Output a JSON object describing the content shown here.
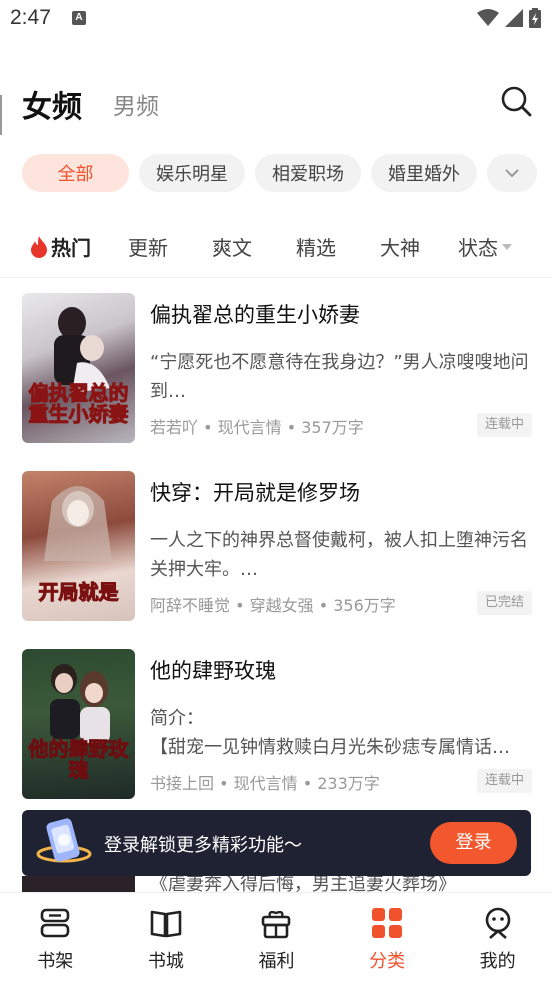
{
  "status_bar": {
    "time": "2:47",
    "notification": "A"
  },
  "top_tabs": {
    "female": "女频",
    "male": "男频"
  },
  "genre_chips": [
    "全部",
    "娱乐明星",
    "相爱职场",
    "婚里婚外"
  ],
  "sort_tabs": {
    "hot": "热门",
    "items": [
      "更新",
      "爽文",
      "精选",
      "大神"
    ],
    "status": "状态"
  },
  "books": [
    {
      "title": "偏执翟总的重生小娇妻",
      "desc": "“宁愿死也不愿意待在我身边？”男人凉嗖嗖地问到…",
      "meta": "若若吖 • 现代言情 • 357万字",
      "badge": "连载中",
      "cover_text": "偏执翟总的重生小娇妻"
    },
    {
      "title": "快穿：开局就是修罗场",
      "desc": "一人之下的神界总督使戴柯，被人扣上堕神污名关押大牢。…",
      "meta": "阿辞不睡觉 • 穿越女强 • 356万字",
      "badge": "已完结",
      "cover_text": "开局就是"
    },
    {
      "title": "他的肆野玫瑰",
      "desc": "简介：\n【甜宠一见钟情救赎白月光朱砂痣专属情话…",
      "meta": "书接上回 • 现代言情 • 233万字",
      "badge": "连载中",
      "cover_text": "他的肆野玫瑰"
    }
  ],
  "peek_text": "《虐妻奔入得后悔，男主追妻火葬场》",
  "login_banner": {
    "text": "登录解锁更多精彩功能～",
    "button": "登录"
  },
  "bottom_nav": [
    {
      "label": "书架",
      "icon": "bookshelf-icon"
    },
    {
      "label": "书城",
      "icon": "book-store-icon"
    },
    {
      "label": "福利",
      "icon": "gift-icon"
    },
    {
      "label": "分类",
      "icon": "category-icon",
      "active": true
    },
    {
      "label": "我的",
      "icon": "profile-icon"
    }
  ],
  "colors": {
    "accent": "#f0532c",
    "banner_bg": "#1e2233",
    "chip_bg": "#f2f2f2"
  }
}
